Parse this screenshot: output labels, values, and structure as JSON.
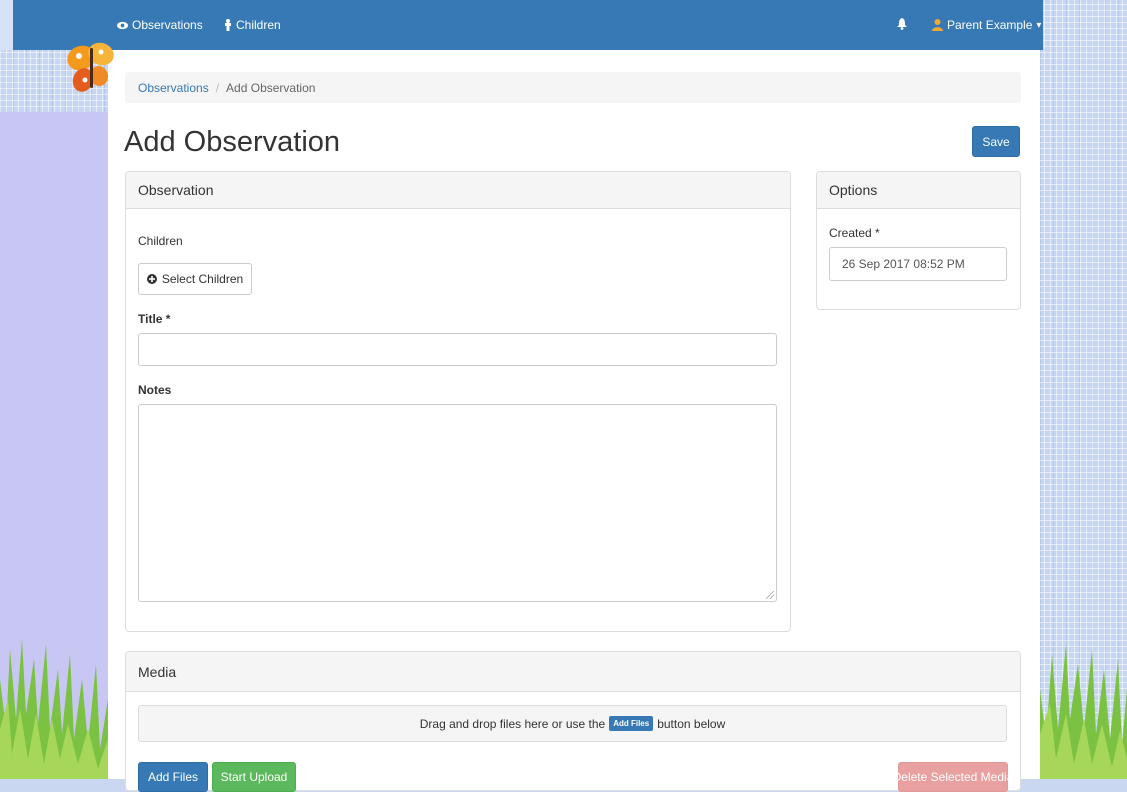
{
  "navbar": {
    "observations_label": "Observations",
    "children_label": "Children",
    "user_label": "Parent Example",
    "bell_icon": "bell-icon",
    "user_icon": "user-icon",
    "eye_icon": "eye-icon",
    "child_icon": "child-icon",
    "caret": "▾"
  },
  "breadcrumb": {
    "parent": "Observations",
    "separator": "/",
    "current": "Add Observation"
  },
  "page": {
    "title": "Add Observation",
    "save_label": "Save"
  },
  "observation_panel": {
    "heading": "Observation",
    "children_label": "Children",
    "select_children_label": "Select Children",
    "title_label": "Title *",
    "title_value": "",
    "notes_label": "Notes",
    "notes_value": ""
  },
  "options_panel": {
    "heading": "Options",
    "created_label": "Created *",
    "created_value": "26 Sep 2017 08:52 PM"
  },
  "media_panel": {
    "heading": "Media",
    "drop_text_before": "Drag and drop files here or use the",
    "drop_badge": "Add Files",
    "drop_text_after": "button below",
    "add_files_label": "Add Files",
    "start_upload_label": "Start Upload",
    "delete_selected_label": "Delete Selected Media"
  },
  "colors": {
    "primary": "#3679b5",
    "success": "#5cb85c",
    "danger": "#e8a0a0",
    "background": "#c6d6f2"
  }
}
